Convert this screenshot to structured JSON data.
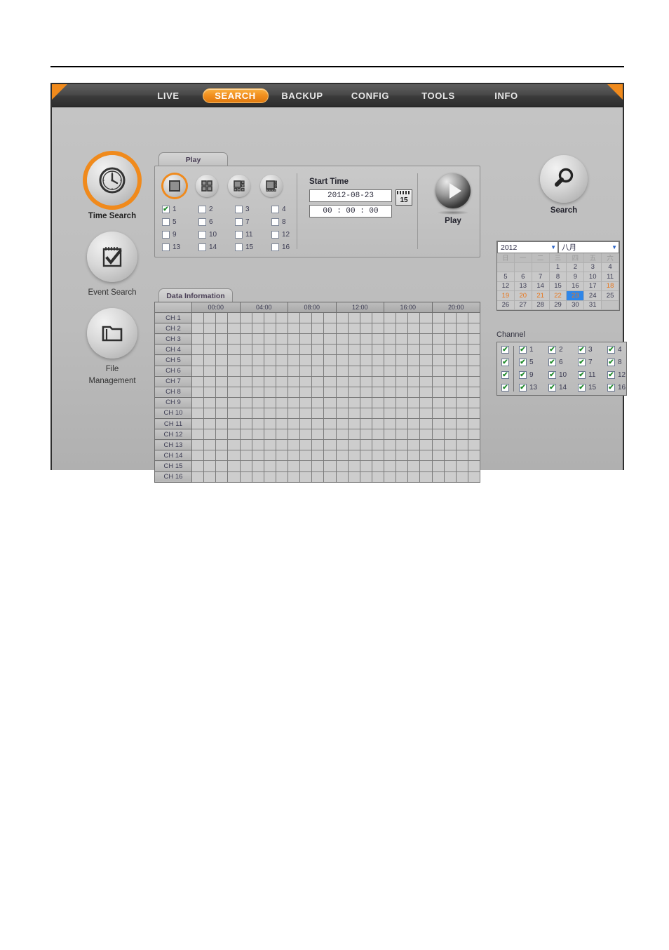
{
  "nav": {
    "items": [
      {
        "label": "LIVE",
        "active": false
      },
      {
        "label": "SEARCH",
        "active": true
      },
      {
        "label": "BACKUP",
        "active": false
      },
      {
        "label": "CONFIG",
        "active": false
      },
      {
        "label": "TOOLS",
        "active": false
      },
      {
        "label": "INFO",
        "active": false
      }
    ]
  },
  "sidebar": {
    "items": [
      {
        "label": "Time Search",
        "icon": "clock-icon",
        "active": true
      },
      {
        "label": "Event Search",
        "icon": "note-check-icon",
        "active": false
      },
      {
        "label": "File",
        "label2": "Management",
        "icon": "folder-icon",
        "active": false
      }
    ]
  },
  "play_panel": {
    "tab_label": "Play",
    "layout_modes": [
      {
        "name": "single-view",
        "active": true
      },
      {
        "name": "quad-view",
        "active": false
      },
      {
        "name": "nine-view",
        "active": false
      },
      {
        "name": "sixteen-view",
        "active": false
      }
    ],
    "channels": [
      {
        "label": "1",
        "checked": true
      },
      {
        "label": "2",
        "checked": false
      },
      {
        "label": "3",
        "checked": false
      },
      {
        "label": "4",
        "checked": false
      },
      {
        "label": "5",
        "checked": false
      },
      {
        "label": "6",
        "checked": false
      },
      {
        "label": "7",
        "checked": false
      },
      {
        "label": "8",
        "checked": false
      },
      {
        "label": "9",
        "checked": false
      },
      {
        "label": "10",
        "checked": false
      },
      {
        "label": "11",
        "checked": false
      },
      {
        "label": "12",
        "checked": false
      },
      {
        "label": "13",
        "checked": false
      },
      {
        "label": "14",
        "checked": false
      },
      {
        "label": "15",
        "checked": false
      },
      {
        "label": "16",
        "checked": false
      }
    ],
    "start_time_label": "Start Time",
    "date_value": "2012-08-23",
    "time_value": "00 : 00 : 00",
    "calendar_button_label": "15",
    "play_label": "Play"
  },
  "data_information": {
    "tab_label": "Data Information",
    "time_headers": [
      "00:00",
      "04:00",
      "08:00",
      "12:00",
      "16:00",
      "20:00"
    ],
    "rows": [
      "CH 1",
      "CH 2",
      "CH 3",
      "CH 4",
      "CH 5",
      "CH 6",
      "CH 7",
      "CH 8",
      "CH 9",
      "CH 10",
      "CH 11",
      "CH 12",
      "CH 13",
      "CH 14",
      "CH 15",
      "CH 16"
    ],
    "columns_per_row": 24
  },
  "search": {
    "label": "Search",
    "icon": "magnifier-icon"
  },
  "calendar": {
    "year": "2012",
    "month": "八月",
    "weekdays": [
      "日",
      "一",
      "二",
      "三",
      "四",
      "五",
      "六"
    ],
    "weeks": [
      [
        {
          "d": ""
        },
        {
          "d": ""
        },
        {
          "d": ""
        },
        {
          "d": "1"
        },
        {
          "d": "2"
        },
        {
          "d": "3"
        },
        {
          "d": "4"
        }
      ],
      [
        {
          "d": "5"
        },
        {
          "d": "6"
        },
        {
          "d": "7"
        },
        {
          "d": "8"
        },
        {
          "d": "9"
        },
        {
          "d": "10"
        },
        {
          "d": "11"
        }
      ],
      [
        {
          "d": "12"
        },
        {
          "d": "13"
        },
        {
          "d": "14"
        },
        {
          "d": "15"
        },
        {
          "d": "16"
        },
        {
          "d": "17"
        },
        {
          "d": "18",
          "rec": true
        }
      ],
      [
        {
          "d": "19",
          "rec": true
        },
        {
          "d": "20",
          "rec": true
        },
        {
          "d": "21",
          "rec": true
        },
        {
          "d": "22",
          "rec": true
        },
        {
          "d": "23",
          "selected": true
        },
        {
          "d": "24"
        },
        {
          "d": "25"
        }
      ],
      [
        {
          "d": "26"
        },
        {
          "d": "27"
        },
        {
          "d": "28"
        },
        {
          "d": "29"
        },
        {
          "d": "30"
        },
        {
          "d": "31"
        },
        {
          "d": ""
        }
      ]
    ],
    "record_color": "#e8761b",
    "selected_bg": "#2f86e8"
  },
  "channel_panel": {
    "title": "Channel",
    "row_select_all": [
      true,
      true,
      true,
      true
    ],
    "channels": [
      {
        "label": "1",
        "checked": true
      },
      {
        "label": "2",
        "checked": true
      },
      {
        "label": "3",
        "checked": true
      },
      {
        "label": "4",
        "checked": true
      },
      {
        "label": "5",
        "checked": true
      },
      {
        "label": "6",
        "checked": true
      },
      {
        "label": "7",
        "checked": true
      },
      {
        "label": "8",
        "checked": true
      },
      {
        "label": "9",
        "checked": true
      },
      {
        "label": "10",
        "checked": true
      },
      {
        "label": "11",
        "checked": true
      },
      {
        "label": "12",
        "checked": true
      },
      {
        "label": "13",
        "checked": true
      },
      {
        "label": "14",
        "checked": true
      },
      {
        "label": "15",
        "checked": true
      },
      {
        "label": "16",
        "checked": true
      }
    ]
  },
  "colors": {
    "accent": "#f08a1c",
    "nav_bg": "#3a3a3a",
    "panel_bg": "#bcbcbc",
    "selected_blue": "#2f86e8"
  }
}
